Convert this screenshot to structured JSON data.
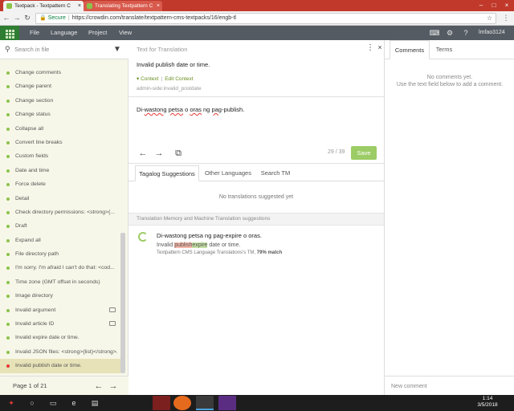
{
  "browser": {
    "tabs": [
      {
        "label": "Textpack - Textpattern C"
      },
      {
        "label": "Translating Textpattern C"
      }
    ],
    "secure_label": "Secure",
    "url": "https://crowdin.com/translate/textpattern-cms-textpacks/16/engb-tl"
  },
  "app": {
    "menu": [
      "File",
      "Language",
      "Project",
      "View"
    ],
    "username": "lmfao3124"
  },
  "sidebar": {
    "search_placeholder": "Search in file",
    "items": [
      {
        "label": "Change comments"
      },
      {
        "label": "Change parent"
      },
      {
        "label": "Change section"
      },
      {
        "label": "Change status"
      },
      {
        "label": "Collapse all"
      },
      {
        "label": "Convert line breaks"
      },
      {
        "label": "Custom fields"
      },
      {
        "label": "Date and time"
      },
      {
        "label": "Force delete"
      },
      {
        "label": "Detail"
      },
      {
        "label": "Check directory permissions: <strong>{..."
      },
      {
        "label": "Draft"
      },
      {
        "label": "Expand all"
      },
      {
        "label": "File directory path"
      },
      {
        "label": "I'm sorry. I'm afraid I can't do that: <cod..."
      },
      {
        "label": "Time zone (GMT offset in seconds)"
      },
      {
        "label": "Image directory"
      },
      {
        "label": "Invalid argument"
      },
      {
        "label": "Invalid article ID"
      },
      {
        "label": "Invalid expire date or time."
      },
      {
        "label": "Invalid JSON files: <strong>{list}</strong>."
      },
      {
        "label": "Invalid publish date or time."
      }
    ],
    "page_label": "Page 1 of 21"
  },
  "source": {
    "header": "Text for Translation",
    "text": "Invalid publish date or time.",
    "context_label": "Context",
    "edit_context_label": "Edit Context",
    "context_key": "admin-side:invalid_postdate"
  },
  "translation": {
    "words": [
      "Di-",
      "wastong",
      " ",
      "petsa",
      " o ",
      "oras",
      " ng ",
      "pag",
      "-publish."
    ],
    "counter": "29 / 39",
    "save_label": "Save"
  },
  "suggestions": {
    "tabs": [
      "Tagalog Suggestions",
      "Other Languages",
      "Search TM"
    ],
    "empty_text": "No translations suggested yet",
    "tm_header": "Translation Memory and Machine Translation suggestions",
    "tm_text": "Di-wastong petsa ng pag-expire o oras.",
    "tm_diff_pre": "Invalid ",
    "tm_diff_removed": "publish",
    "tm_diff_added": "expire",
    "tm_diff_post": " date or time.",
    "tm_source": "Textpattern CMS Language Translations's TM,",
    "tm_match": "79% match"
  },
  "comments": {
    "tabs": [
      "Comments",
      "Terms"
    ],
    "empty_line1": "No comments yet.",
    "empty_line2": "Use the text field below to add a comment.",
    "new_placeholder": "New comment"
  },
  "taskbar": {
    "time": "1:14",
    "date": "3/5/2018"
  },
  "colors": {
    "tab_bar": "#c0392b",
    "menubar": "#545b63",
    "accent_green": "#8bc34a",
    "save_button": "#9ccc65",
    "selected_item": "#e7e2b8",
    "sidebar_bg": "#f7f7e9"
  }
}
